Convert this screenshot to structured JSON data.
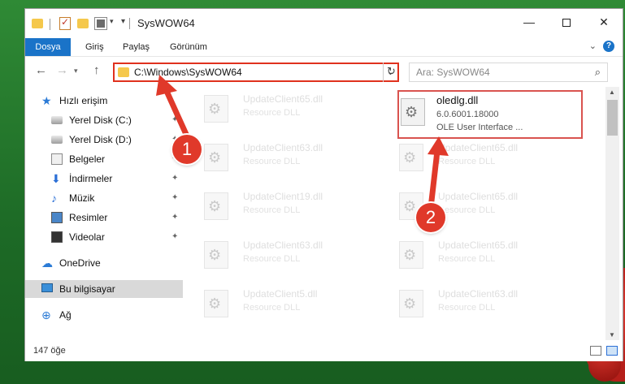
{
  "window": {
    "title": "SysWOW64",
    "minimize": "—",
    "close": "✕"
  },
  "ribbon": {
    "file": "Dosya",
    "tabs": [
      "Giriş",
      "Paylaş",
      "Görünüm"
    ],
    "expand": "⌄",
    "help": "?"
  },
  "nav": {
    "back": "←",
    "forward": "→",
    "recent": "▾",
    "up": "↑",
    "address": "C:\\Windows\\SysWOW64",
    "address_drop": "⌄",
    "refresh": "↻",
    "search_placeholder": "Ara: SysWOW64",
    "search_icon": "⌕"
  },
  "sidebar": {
    "items": [
      {
        "label": "Hızlı erişim",
        "icon": "star-icon"
      },
      {
        "label": "Yerel Disk (C:)",
        "icon": "drive-icon",
        "pin": "📌"
      },
      {
        "label": "Yerel Disk (D:)",
        "icon": "drive-icon",
        "pin": "📌"
      },
      {
        "label": "Belgeler",
        "icon": "documents-icon",
        "pin": "📌"
      },
      {
        "label": "İndirmeler",
        "icon": "download-icon",
        "pin": "📌"
      },
      {
        "label": "Müzik",
        "icon": "music-icon",
        "pin": "📌"
      },
      {
        "label": "Resimler",
        "icon": "pictures-icon",
        "pin": "📌"
      },
      {
        "label": "Videolar",
        "icon": "video-icon",
        "pin": "📌"
      },
      {
        "label": "OneDrive",
        "icon": "cloud-icon"
      },
      {
        "label": "Bu bilgisayar",
        "icon": "computer-icon",
        "selected": true
      },
      {
        "label": "Ağ",
        "icon": "network-icon"
      }
    ]
  },
  "files": [
    {
      "name": "UpdateClient65.dll",
      "desc": "Resource DLL"
    },
    {
      "name": "UpdateClient63.dll",
      "desc": "Resource DLL"
    },
    {
      "name": "UpdateClient65.dll",
      "desc": "Resource DLL"
    },
    {
      "name": "UpdateClient19.dll",
      "desc": "Resource DLL"
    },
    {
      "name": "UpdateClient65.dll",
      "desc": "Resource DLL"
    },
    {
      "name": "UpdateClient63.dll",
      "desc": "Resource DLL"
    },
    {
      "name": "UpdateClient65.dll",
      "desc": "Resource DLL"
    },
    {
      "name": "UpdateClient5.dll",
      "desc": "Resource DLL"
    },
    {
      "name": "UpdateClient63.dll",
      "desc": "Resource DLL"
    }
  ],
  "highlighted_file": {
    "name": "oledlg.dll",
    "version": "6.0.6001.18000",
    "desc": "OLE User Interface ..."
  },
  "status": {
    "count": "147 öğe"
  },
  "annotations": {
    "step1": "1",
    "step2": "2",
    "color": "#e0392a"
  }
}
